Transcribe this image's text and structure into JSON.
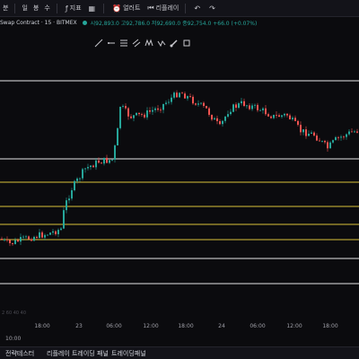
{
  "toolbar": {
    "interval_label": "분",
    "tools": [
      "일",
      "봉",
      "수"
    ],
    "indicators_label": "지표",
    "layout_label": "얼러트",
    "replay_label": "리플레이"
  },
  "legend": {
    "symbol": "Swap Contract · 15 · BITMEX",
    "ohlc": "시92,893.0 고92,786.0 저92,690.0 종92,754.0 +66.0 (+0.07%)"
  },
  "drawing_tools": [
    "line-tool",
    "horizontal-ray-tool",
    "fib-tool",
    "parallel-channel-tool",
    "pattern-tool",
    "xabcd-tool",
    "brush-tool",
    "shapes-tool"
  ],
  "chart_data": {
    "type": "candlestick",
    "price_direction": [
      "down",
      "flat",
      "up",
      "surge",
      "up",
      "choppy",
      "down",
      "flat"
    ],
    "horizontal_levels_colors": {
      "white": "#e6e6e6",
      "yellow": "#d9c239"
    },
    "up_color": "#26a69a",
    "down_color": "#ef5350"
  },
  "watermark": "2 60 40 40",
  "time_axis": {
    "labels": [
      "18:00",
      "23",
      "06:00",
      "12:00",
      "18:00",
      "24",
      "06:00",
      "12:00",
      "18:00"
    ]
  },
  "timezone_label": "10:00",
  "bottom_tabs": [
    "전략테스터",
    "리플레이 트레이딩 패널",
    "트레이딩패널"
  ]
}
